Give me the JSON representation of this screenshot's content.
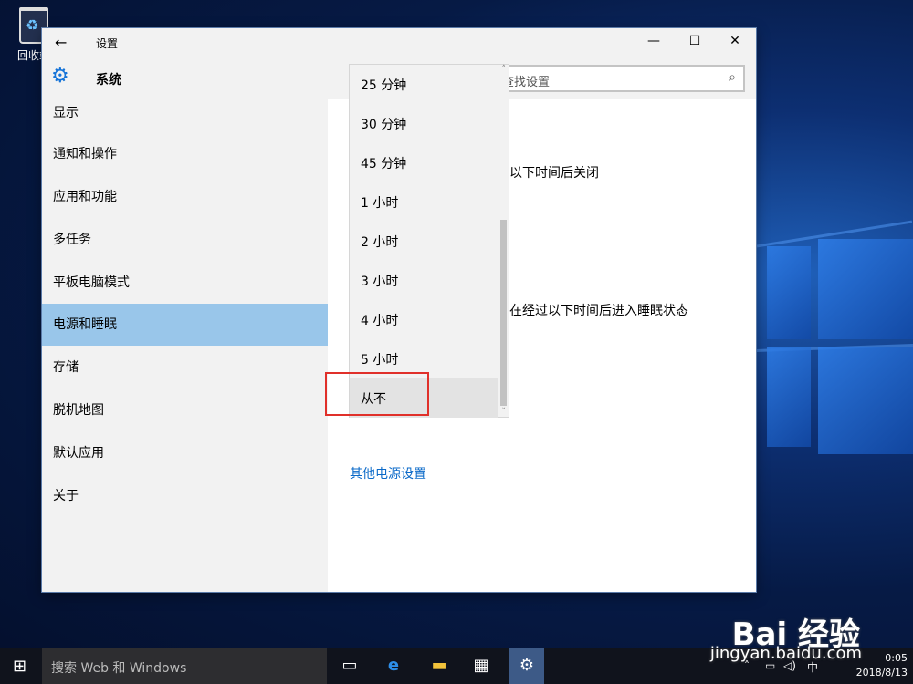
{
  "desktop": {
    "recycle_bin_label": "回收站"
  },
  "window": {
    "title": "设置",
    "back_glyph": "←",
    "minimize_glyph": "—",
    "maximize_glyph": "☐",
    "close_glyph": "✕",
    "section_title": "系统",
    "search_placeholder": "查找设置",
    "search_icon_glyph": "⌕"
  },
  "sidebar": {
    "items": [
      {
        "label": "显示"
      },
      {
        "label": "通知和操作"
      },
      {
        "label": "应用和功能"
      },
      {
        "label": "多任务"
      },
      {
        "label": "平板电脑模式"
      },
      {
        "label": "电源和睡眠"
      },
      {
        "label": "存储"
      },
      {
        "label": "脱机地图"
      },
      {
        "label": "默认应用"
      },
      {
        "label": "关于"
      }
    ],
    "active_index": 5
  },
  "content": {
    "screen_off_text": "以下时间后关闭",
    "sleep_text": "在经过以下时间后进入睡眠状态",
    "other_power_link": "其他电源设置"
  },
  "dropdown": {
    "options": [
      {
        "label": "25 分钟"
      },
      {
        "label": "30 分钟"
      },
      {
        "label": "45 分钟"
      },
      {
        "label": "1 小时"
      },
      {
        "label": "2 小时"
      },
      {
        "label": "3 小时"
      },
      {
        "label": "4 小时"
      },
      {
        "label": "5 小时"
      },
      {
        "label": "从不"
      }
    ],
    "highlighted_label": "从不",
    "scroll_up_glyph": "˄",
    "scroll_down_glyph": "˅"
  },
  "taskbar": {
    "start_glyph": "⊞",
    "search_text": "搜索 Web 和 Windows",
    "task_view_glyph": "▭",
    "edge_glyph": "e",
    "explorer_glyph": "▬",
    "store_glyph": "▦",
    "settings_glyph": "⚙",
    "tray_up_glyph": "˄",
    "tray_network_glyph": "▭",
    "tray_volume_glyph": "◁)",
    "ime_label": "中",
    "time": "0:05",
    "date": "2018/8/13"
  },
  "watermark": {
    "brand": "Bai 经验",
    "url": "jingyan.baidu.com"
  },
  "colors": {
    "accent": "#1674d8",
    "active_nav": "#99c6ea",
    "link": "#0a69c8",
    "highlight_box": "#e0302a"
  }
}
